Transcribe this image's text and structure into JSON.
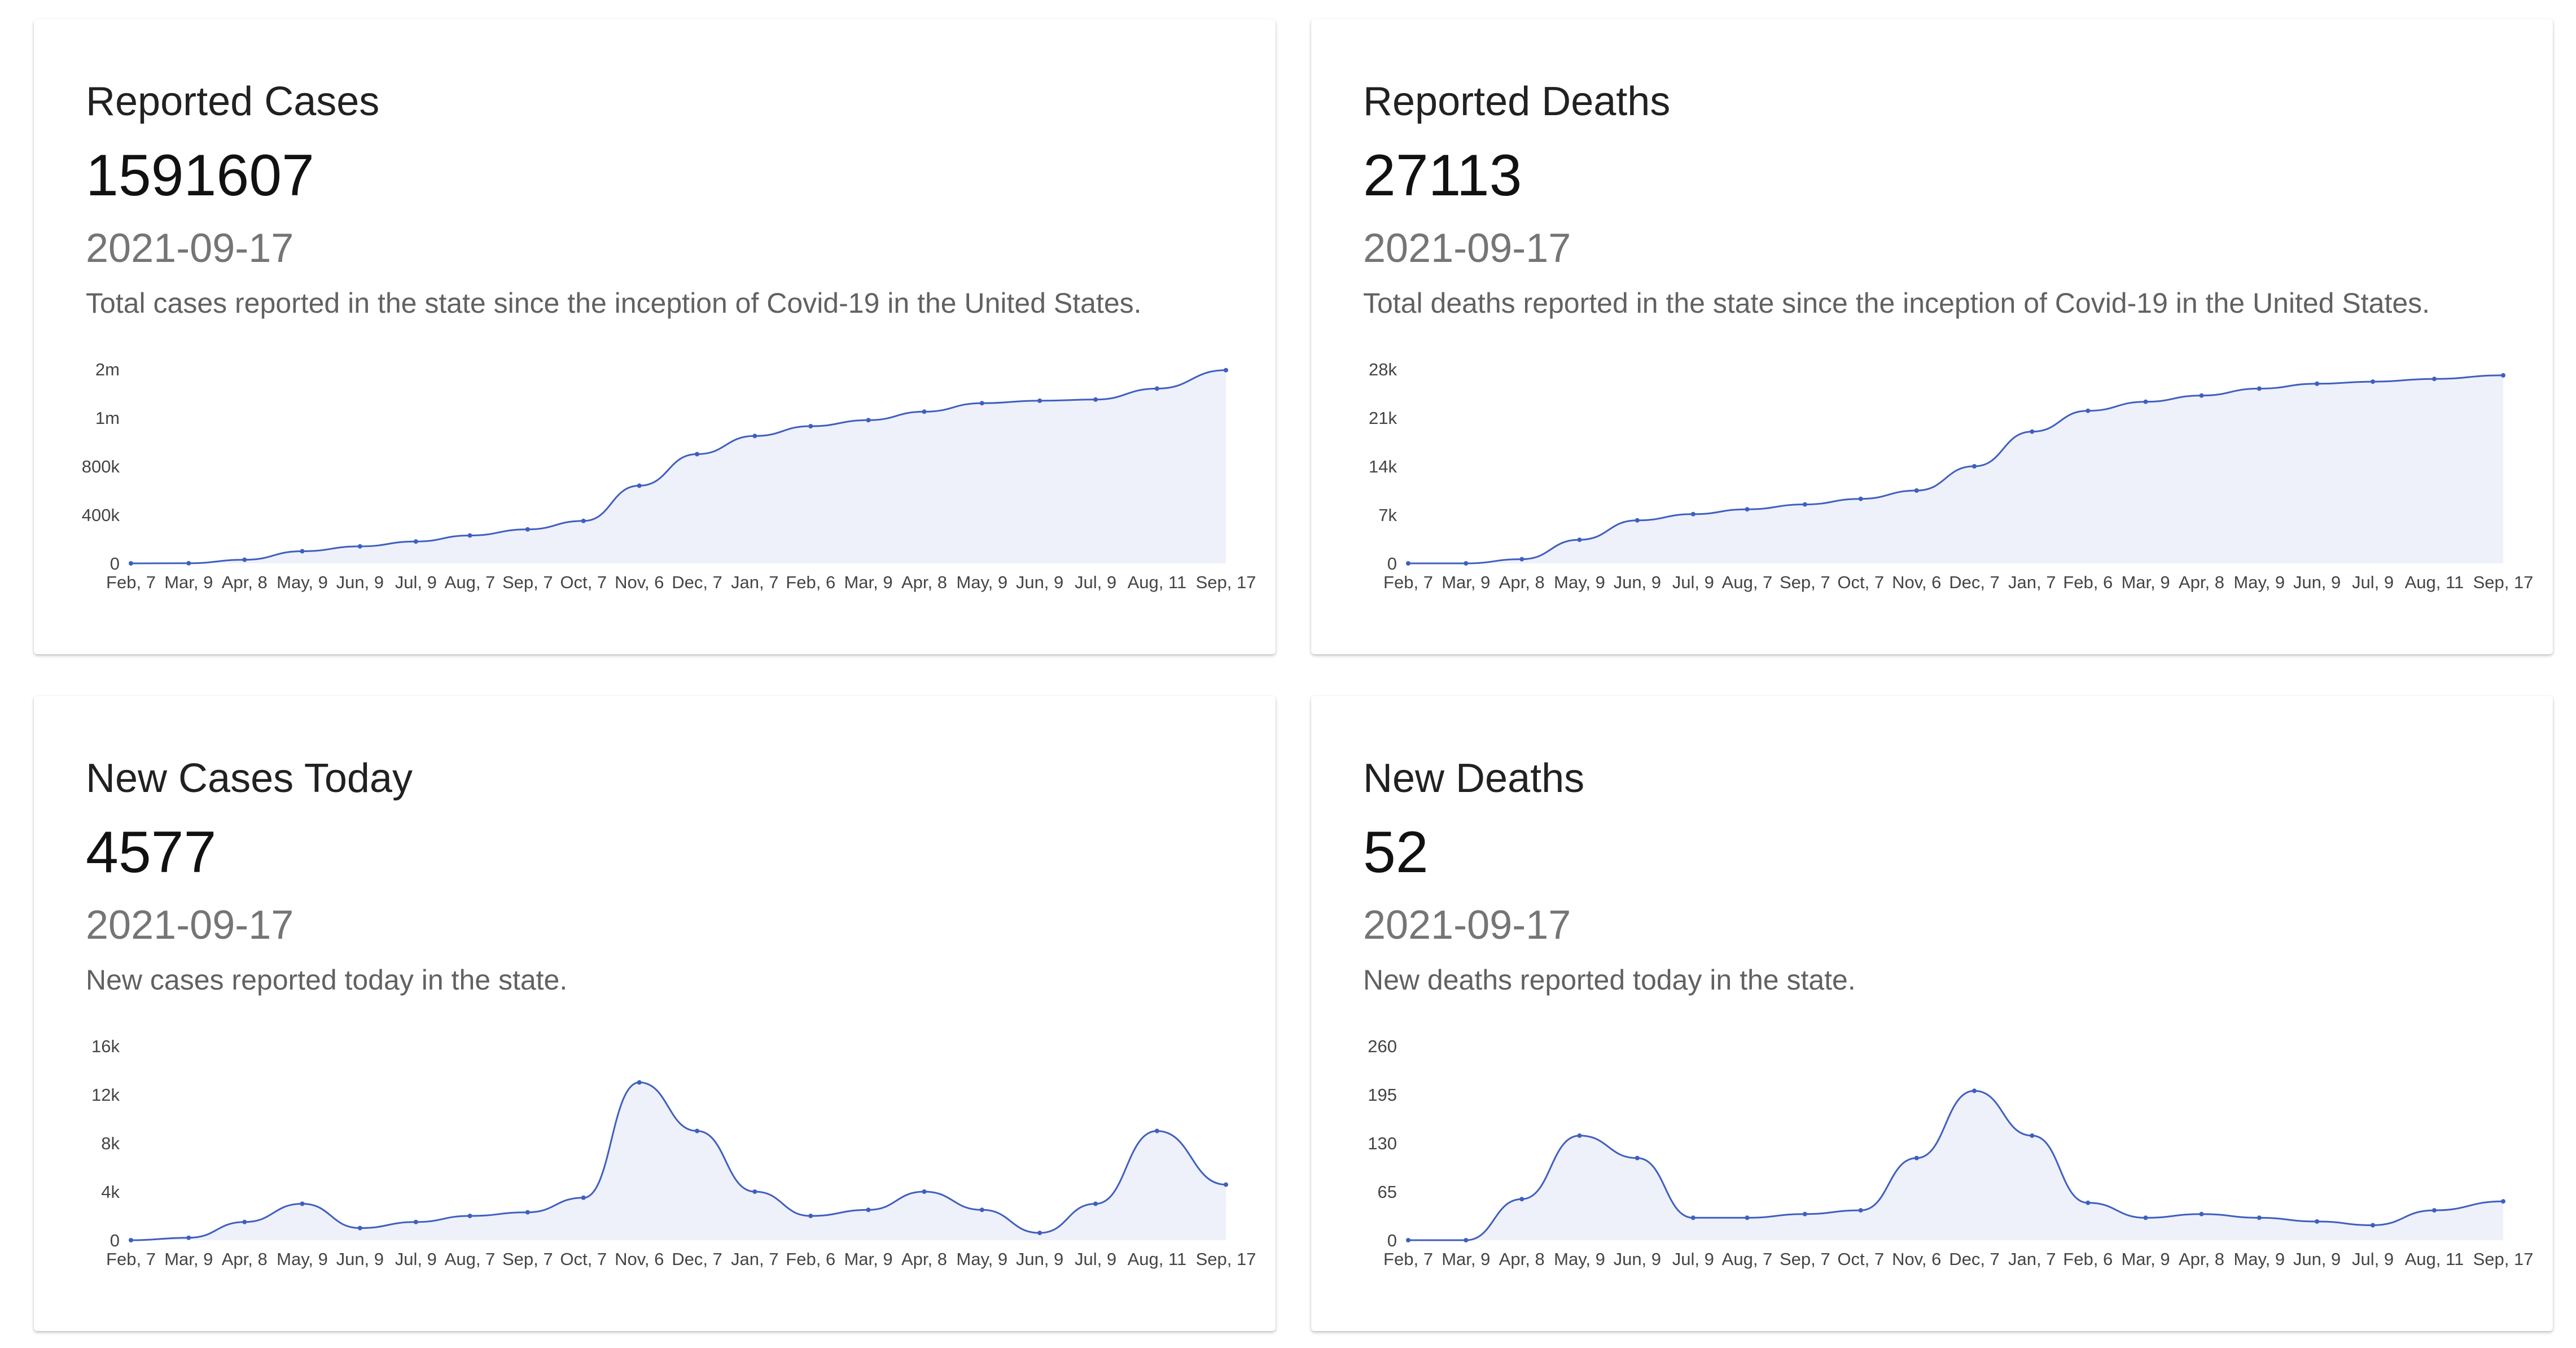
{
  "cards": [
    {
      "title": "Reported Cases",
      "value": "1591607",
      "date": "2021-09-17",
      "description": "Total cases reported in the state since the inception of Covid-19 in the United States."
    },
    {
      "title": "Reported Deaths",
      "value": "27113",
      "date": "2021-09-17",
      "description": "Total deaths reported in the state since the inception of Covid-19 in the United States."
    },
    {
      "title": "New Cases Today",
      "value": "4577",
      "date": "2021-09-17",
      "description": "New cases reported today in the state."
    },
    {
      "title": "New Deaths",
      "value": "52",
      "date": "2021-09-17",
      "description": "New deaths reported today in the state."
    }
  ],
  "colors": {
    "line": "#3f5fbf",
    "area": "#eef0fa"
  },
  "x_ticks": [
    "Feb, 7",
    "Mar, 9",
    "Apr, 8",
    "May, 9",
    "Jun, 9",
    "Jul, 9",
    "Aug, 7",
    "Sep, 7",
    "Oct, 7",
    "Nov, 6",
    "Dec, 7",
    "Jan, 7",
    "Feb, 6",
    "Mar, 9",
    "Apr, 8",
    "May, 9",
    "Jun, 9",
    "Jul, 9",
    "Aug, 11",
    "Sep, 17"
  ],
  "chart_data": [
    {
      "type": "area",
      "title": "",
      "xlabel": "",
      "ylabel": "",
      "ylim": [
        0,
        1600000
      ],
      "y_ticks": [
        0,
        400000,
        800000,
        1200000,
        1600000
      ],
      "y_tick_labels": [
        "0",
        "400k",
        "800k",
        "1m",
        "2m"
      ],
      "x": [
        "2020-02-07",
        "2020-03-09",
        "2020-04-08",
        "2020-05-09",
        "2020-06-09",
        "2020-07-09",
        "2020-08-07",
        "2020-09-07",
        "2020-10-07",
        "2020-11-06",
        "2020-12-07",
        "2021-01-07",
        "2021-02-06",
        "2021-03-09",
        "2021-04-08",
        "2021-05-09",
        "2021-06-09",
        "2021-07-09",
        "2021-08-11",
        "2021-09-17"
      ],
      "values": [
        0,
        1000,
        30000,
        100000,
        140000,
        180000,
        230000,
        280000,
        350000,
        640000,
        900000,
        1050000,
        1130000,
        1180000,
        1250000,
        1320000,
        1340000,
        1350000,
        1440000,
        1591607
      ]
    },
    {
      "type": "area",
      "title": "",
      "xlabel": "",
      "ylabel": "",
      "ylim": [
        0,
        28000
      ],
      "y_ticks": [
        0,
        7000,
        14000,
        21000,
        28000
      ],
      "y_tick_labels": [
        "0",
        "7k",
        "14k",
        "21k",
        "28k"
      ],
      "x": [
        "2020-02-07",
        "2020-03-09",
        "2020-04-08",
        "2020-05-09",
        "2020-06-09",
        "2020-07-09",
        "2020-08-07",
        "2020-09-07",
        "2020-10-07",
        "2020-11-06",
        "2020-12-07",
        "2021-01-07",
        "2021-02-06",
        "2021-03-09",
        "2021-04-08",
        "2021-05-09",
        "2021-06-09",
        "2021-07-09",
        "2021-08-11",
        "2021-09-17"
      ],
      "values": [
        0,
        0,
        600,
        3400,
        6200,
        7100,
        7800,
        8500,
        9300,
        10500,
        14000,
        19000,
        22000,
        23300,
        24200,
        25200,
        25900,
        26200,
        26600,
        27113
      ]
    },
    {
      "type": "line",
      "title": "",
      "xlabel": "",
      "ylabel": "",
      "ylim": [
        0,
        16000
      ],
      "y_ticks": [
        0,
        4000,
        8000,
        12000,
        16000
      ],
      "y_tick_labels": [
        "0",
        "4k",
        "8k",
        "12k",
        "16k"
      ],
      "x": [
        "2020-02-07",
        "2020-03-09",
        "2020-04-08",
        "2020-05-09",
        "2020-06-09",
        "2020-07-09",
        "2020-08-07",
        "2020-09-07",
        "2020-10-07",
        "2020-11-06",
        "2020-12-07",
        "2021-01-07",
        "2021-02-06",
        "2021-03-09",
        "2021-04-08",
        "2021-05-09",
        "2021-06-09",
        "2021-07-09",
        "2021-08-11",
        "2021-09-17"
      ],
      "values": [
        0,
        200,
        1500,
        3000,
        1000,
        1500,
        2000,
        2300,
        3500,
        13000,
        9000,
        4000,
        2000,
        2500,
        4000,
        2500,
        600,
        3000,
        9000,
        4577
      ]
    },
    {
      "type": "line",
      "title": "",
      "xlabel": "",
      "ylabel": "",
      "ylim": [
        0,
        260
      ],
      "y_ticks": [
        0,
        65,
        130,
        195,
        260
      ],
      "y_tick_labels": [
        "0",
        "65",
        "130",
        "195",
        "260"
      ],
      "x": [
        "2020-02-07",
        "2020-03-09",
        "2020-04-08",
        "2020-05-09",
        "2020-06-09",
        "2020-07-09",
        "2020-08-07",
        "2020-09-07",
        "2020-10-07",
        "2020-11-06",
        "2020-12-07",
        "2021-01-07",
        "2021-02-06",
        "2021-03-09",
        "2021-04-08",
        "2021-05-09",
        "2021-06-09",
        "2021-07-09",
        "2021-08-11",
        "2021-09-17"
      ],
      "values": [
        0,
        0,
        55,
        140,
        110,
        30,
        30,
        35,
        40,
        110,
        200,
        140,
        50,
        30,
        35,
        30,
        25,
        20,
        40,
        52
      ]
    }
  ]
}
